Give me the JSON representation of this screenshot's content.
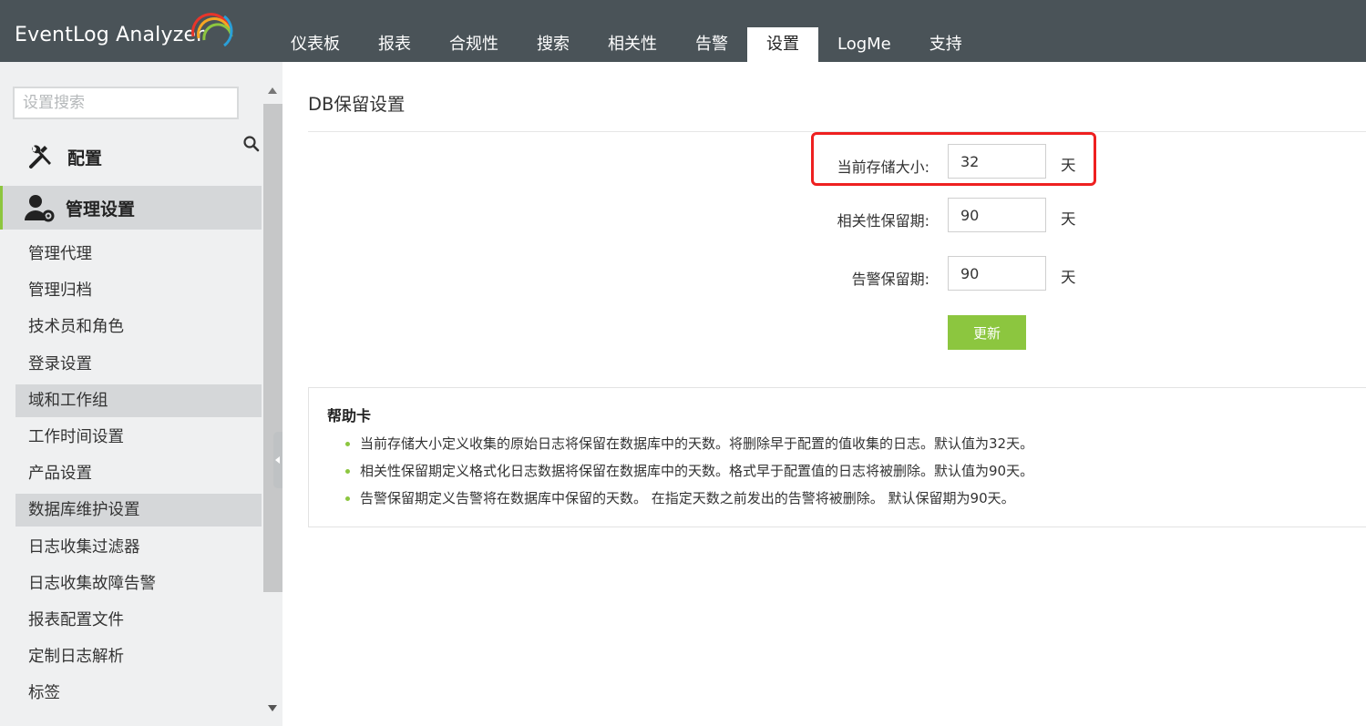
{
  "app": {
    "logo_text": "EventLog Analyzer",
    "brand_colors": [
      "#e8352a",
      "#f5a623",
      "#8dc63f",
      "#2a9fd8"
    ]
  },
  "nav": {
    "items": [
      {
        "label": "仪表板"
      },
      {
        "label": "报表"
      },
      {
        "label": "合规性"
      },
      {
        "label": "搜索"
      },
      {
        "label": "相关性"
      },
      {
        "label": "告警"
      },
      {
        "label": "设置",
        "active": true
      },
      {
        "label": "LogMe"
      },
      {
        "label": "支持"
      }
    ]
  },
  "sidebar": {
    "search_placeholder": "设置搜索",
    "sections": {
      "config": {
        "label": "配置",
        "icon": "tools-icon"
      },
      "admin": {
        "label": "管理设置",
        "icon": "user-gear-icon"
      }
    },
    "items": [
      {
        "label": "管理代理"
      },
      {
        "label": "管理归档"
      },
      {
        "label": "技术员和角色"
      },
      {
        "label": "登录设置"
      },
      {
        "label": "域和工作组",
        "highlighted": true
      },
      {
        "label": "工作时间设置"
      },
      {
        "label": "产品设置"
      },
      {
        "label": "数据库维护设置",
        "highlighted": true
      },
      {
        "label": "日志收集过滤器"
      },
      {
        "label": "日志收集故障告警"
      },
      {
        "label": "报表配置文件"
      },
      {
        "label": "定制日志解析"
      },
      {
        "label": "标签"
      }
    ]
  },
  "main": {
    "title": "DB保留设置",
    "fields": {
      "storage": {
        "label": "当前存储大小:",
        "value": "32",
        "unit": "天"
      },
      "correlation": {
        "label": "相关性保留期:",
        "value": "90",
        "unit": "天"
      },
      "alert": {
        "label": "告警保留期:",
        "value": "90",
        "unit": "天"
      }
    },
    "update_label": "更新",
    "accent_color": "#8cc63f",
    "highlight_color": "#ee2020"
  },
  "help": {
    "title": "帮助卡",
    "items": [
      "当前存储大小定义收集的原始日志将保留在数据库中的天数。将删除早于配置的值收集的日志。默认值为32天。",
      "相关性保留期定义格式化日志数据将保留在数据库中的天数。格式早于配置值的日志将被删除。默认值为90天。",
      "告警保留期定义告警将在数据库中保留的天数。 在指定天数之前发出的告警将被删除。 默认保留期为90天。"
    ]
  }
}
